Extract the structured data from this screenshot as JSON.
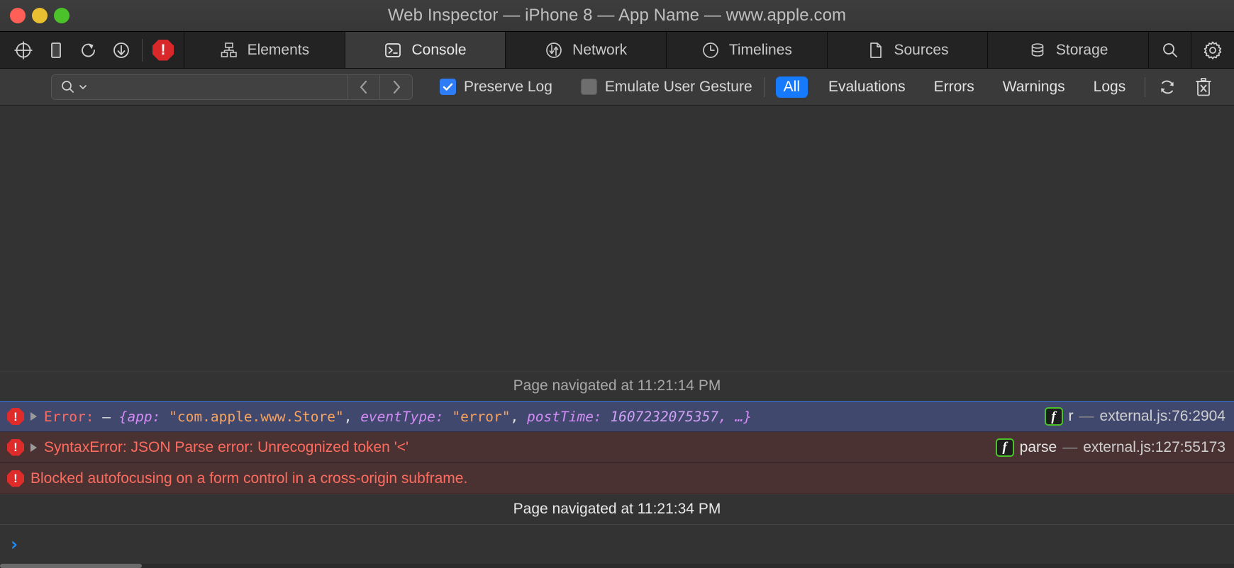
{
  "window": {
    "title": "Web Inspector — iPhone 8 — App Name — www.apple.com",
    "traffic_lights": [
      "close",
      "minimize",
      "zoom"
    ],
    "colors": {
      "close": "#ff5f57",
      "minimize": "#e8bf30",
      "zoom": "#4cc22a"
    }
  },
  "toolbar": {
    "left_icons": [
      {
        "name": "inspect-element-icon",
        "label": "Inspect Element"
      },
      {
        "name": "device-icon",
        "label": "Device Settings"
      },
      {
        "name": "reload-icon",
        "label": "Reload Page"
      },
      {
        "name": "download-icon",
        "label": "Download Web Archive"
      }
    ],
    "error_badge": "!",
    "tabs": [
      {
        "label": "Elements",
        "icon": "elements-icon",
        "active": false
      },
      {
        "label": "Console",
        "icon": "console-icon",
        "active": true
      },
      {
        "label": "Network",
        "icon": "network-icon",
        "active": false
      },
      {
        "label": "Timelines",
        "icon": "timelines-icon",
        "active": false
      },
      {
        "label": "Sources",
        "icon": "sources-icon",
        "active": false
      },
      {
        "label": "Storage",
        "icon": "storage-icon",
        "active": false
      }
    ],
    "right_icons": [
      {
        "name": "search-icon",
        "label": "Search"
      },
      {
        "name": "gear-icon",
        "label": "Settings"
      }
    ]
  },
  "filterbar": {
    "search": {
      "value": "",
      "placeholder": ""
    },
    "nav_back": "‹",
    "nav_forward": "›",
    "checkboxes": [
      {
        "label": "Preserve Log",
        "checked": true
      },
      {
        "label": "Emulate User Gesture",
        "checked": false
      }
    ],
    "scopes": [
      {
        "label": "All",
        "selected": true
      },
      {
        "label": "Evaluations",
        "selected": false
      },
      {
        "label": "Errors",
        "selected": false
      },
      {
        "label": "Warnings",
        "selected": false
      },
      {
        "label": "Logs",
        "selected": false
      }
    ],
    "actions": [
      {
        "name": "clear-on-navigate-icon",
        "label": "Clear log on navigation"
      },
      {
        "name": "trash-icon",
        "label": "Clear log"
      }
    ],
    "accent_color": "#157afb"
  },
  "console": {
    "divider_top": "Page navigated at 11:21:14 PM",
    "divider_bottom": "Page navigated at 11:21:34 PM",
    "messages": [
      {
        "level": "error",
        "selected": true,
        "expandable": true,
        "parts": {
          "label": "Error:",
          "dash": " – ",
          "open_brace": "{",
          "key1": "app:",
          "val1": "\"com.apple.www.Store\"",
          "sep1": ", ",
          "key2": "eventType:",
          "val2": "\"error\"",
          "sep2": ", ",
          "key3": "postTime:",
          "val3": "1607232075357",
          "ellipsis": ", …}"
        },
        "source": {
          "badge": "f",
          "function": "r",
          "dash": "—",
          "file": "external.js:76:2904"
        }
      },
      {
        "level": "error",
        "selected": false,
        "expandable": true,
        "text": "SyntaxError: JSON Parse error: Unrecognized token '<'",
        "source": {
          "badge": "f",
          "function": "parse",
          "dash": "—",
          "file": "external.js:127:55173"
        }
      },
      {
        "level": "error",
        "selected": false,
        "expandable": false,
        "text": "Blocked autofocusing on a form control in a cross-origin subframe.",
        "source": null
      }
    ],
    "prompt": {
      "caret": "›",
      "value": "",
      "placeholder": ""
    }
  }
}
